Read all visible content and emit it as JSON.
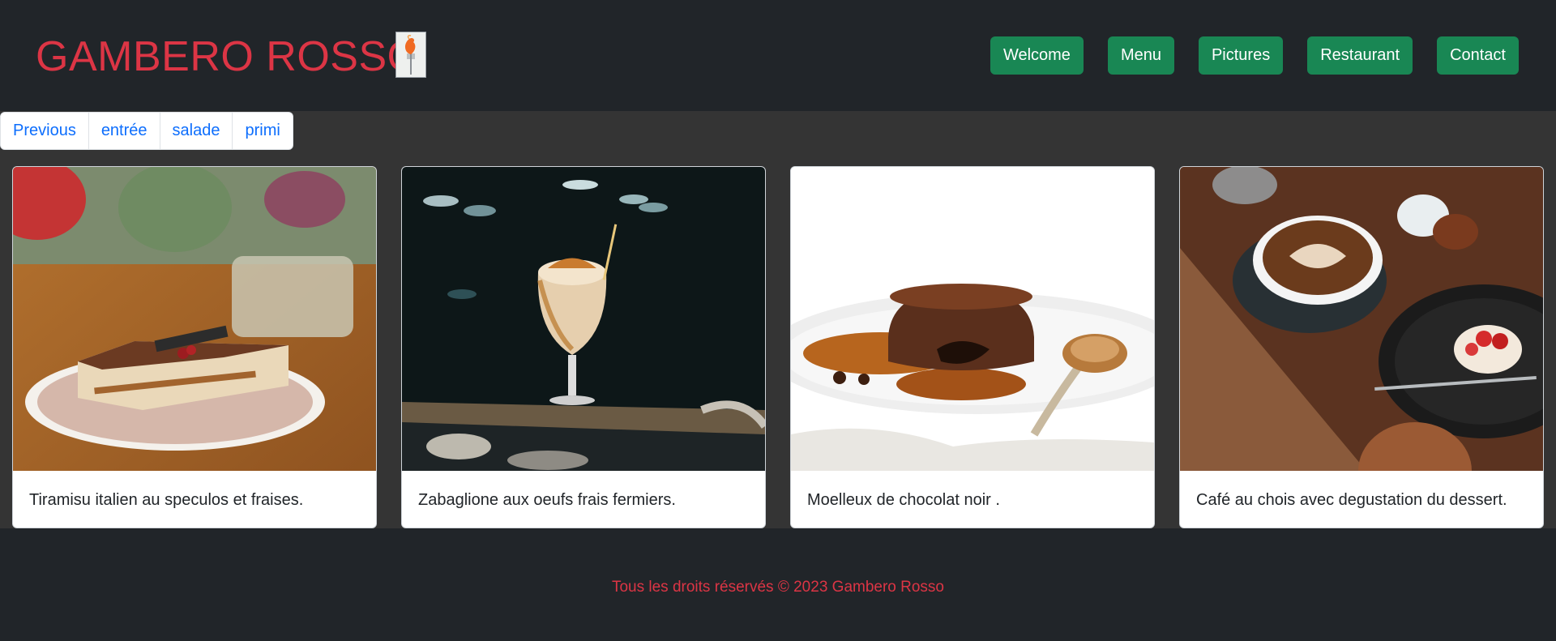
{
  "header": {
    "brand": "GAMBERO ROSSO",
    "logo_icon": "shrimp-fork-logo-icon",
    "nav": [
      "Welcome",
      "Menu",
      "Pictures",
      "Restaurant",
      "Contact"
    ]
  },
  "pagination": [
    "Previous",
    "entrée",
    "salade",
    "primi"
  ],
  "cards": [
    {
      "text": "Tiramisu italien au speculos et fraises.",
      "image": "tiramisu-image"
    },
    {
      "text": "Zabaglione aux oeufs frais fermiers.",
      "image": "zabaglione-glass-image"
    },
    {
      "text": "Moelleux de chocolat noir .",
      "image": "chocolate-lava-cake-image"
    },
    {
      "text": "Café au chois avec degustation du dessert.",
      "image": "coffee-and-dessert-image"
    }
  ],
  "footer": {
    "copyright": "Tous les droits réservés © 2023 Gambero Rosso"
  },
  "colors": {
    "brand_red": "#dc3545",
    "nav_green": "#198754",
    "link_blue": "#0d6efd",
    "header_bg": "#212529",
    "main_bg": "#343434"
  }
}
